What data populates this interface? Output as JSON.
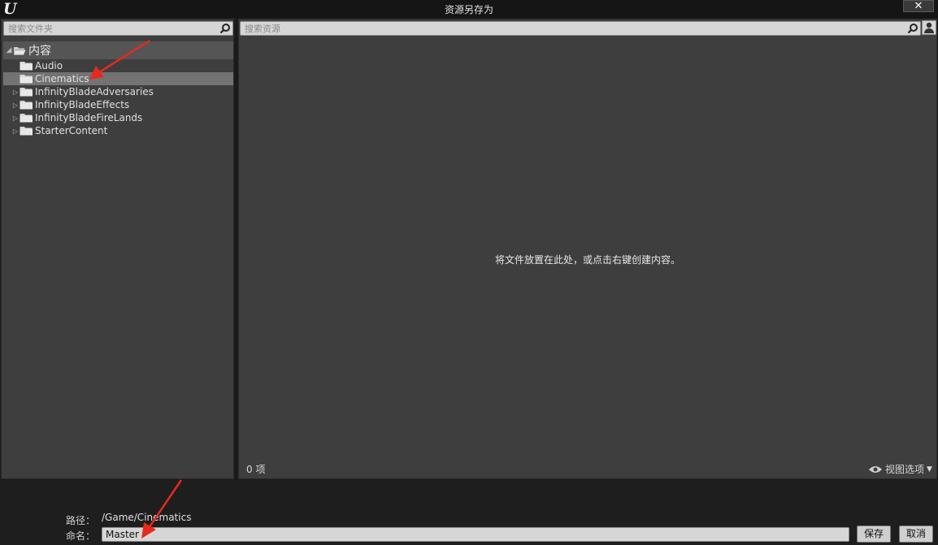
{
  "window": {
    "title": "资源另存为",
    "logo_letter": "U",
    "close_label": "✕"
  },
  "folders": {
    "search_placeholder": "搜索文件夹",
    "root_label": "内容",
    "items": [
      {
        "label": "Audio",
        "expandable": false,
        "selected": false
      },
      {
        "label": "Cinematics",
        "expandable": false,
        "selected": true
      },
      {
        "label": "InfinityBladeAdversaries",
        "expandable": true,
        "selected": false
      },
      {
        "label": "InfinityBladeEffects",
        "expandable": true,
        "selected": false
      },
      {
        "label": "InfinityBladeFireLands",
        "expandable": true,
        "selected": false
      },
      {
        "label": "StarterContent",
        "expandable": true,
        "selected": false
      }
    ]
  },
  "assets": {
    "search_placeholder": "搜索资源",
    "empty_message": "将文件放置在此处，或点击右键创建内容。",
    "item_count": "0 项",
    "view_options_label": "视图选项"
  },
  "footer": {
    "path_label": "路径：",
    "path_value": "/Game/Cinematics",
    "name_label": "命名：",
    "name_value": "Master",
    "save_label": "保存",
    "cancel_label": "取消"
  },
  "colors": {
    "annotation_arrow": "#e8291c",
    "panel_bg": "#3e3e3e",
    "selected_row": "#737373"
  }
}
